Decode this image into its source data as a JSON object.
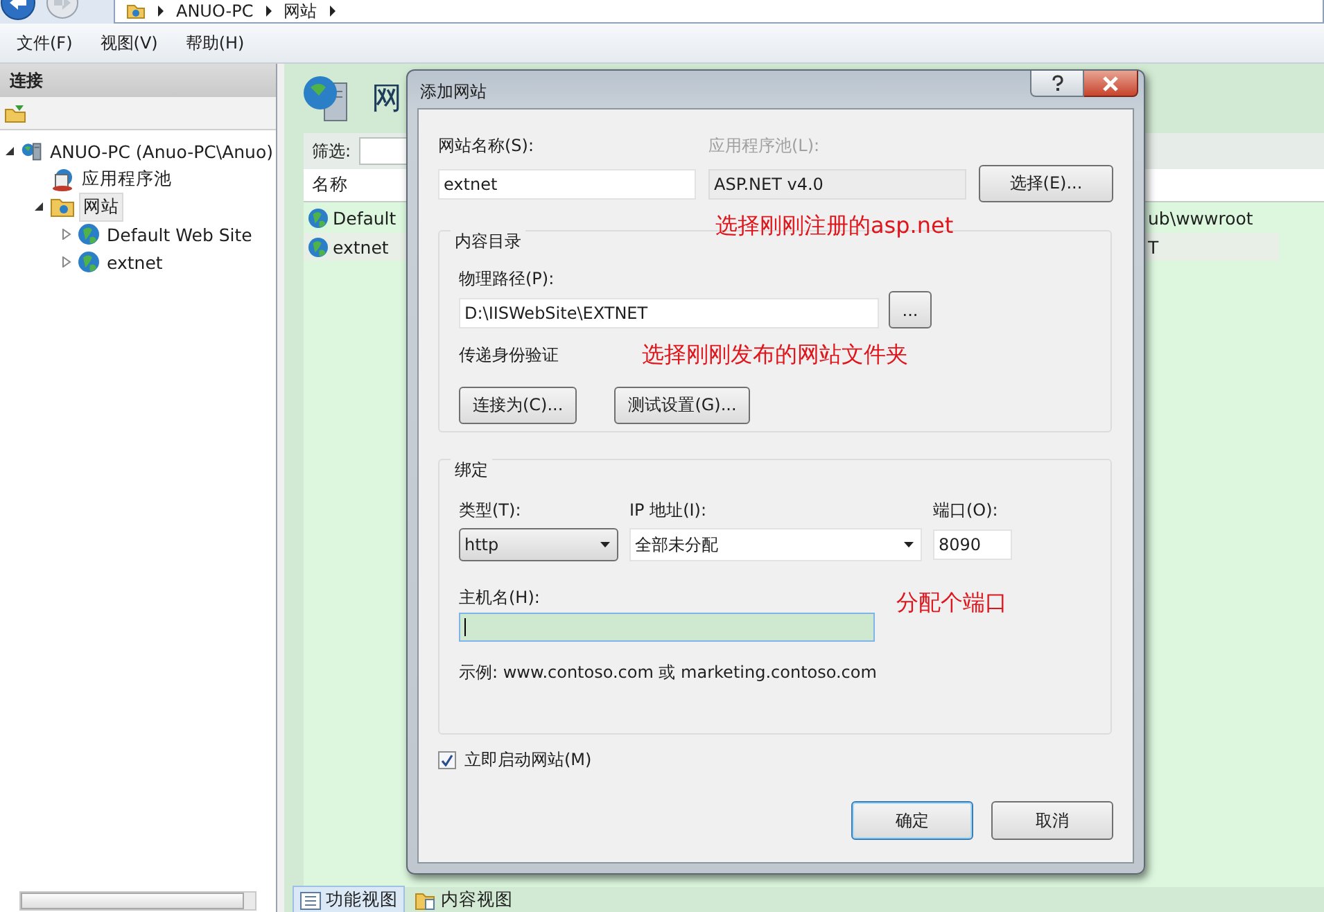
{
  "address_bar": {
    "crumbs": [
      "ANUO-PC",
      "网站"
    ]
  },
  "menu": [
    "文件(F)",
    "视图(V)",
    "帮助(H)"
  ],
  "connections": {
    "title": "连接",
    "tree": [
      {
        "label": "ANUO-PC (Anuo-PC\\Anuo)",
        "kind": "server",
        "expanded": true,
        "selected": false,
        "children": [
          {
            "label": "应用程序池",
            "kind": "pools",
            "selected": false
          },
          {
            "label": "网站",
            "kind": "sites",
            "expanded": true,
            "selected": true,
            "children": [
              {
                "label": "Default Web Site",
                "kind": "site",
                "expanded": false,
                "selected": false
              },
              {
                "label": "extnet",
                "kind": "site",
                "expanded": false,
                "selected": false
              }
            ]
          }
        ]
      }
    ]
  },
  "sites_page": {
    "title": "网",
    "filter_label": "筛选:",
    "columns": [
      "名称"
    ],
    "rows": [
      {
        "name": "Default",
        "column_2": "ub\\wwwroot",
        "selected": false
      },
      {
        "name": "extnet",
        "column_2": "T",
        "selected": true
      }
    ]
  },
  "view_tabs": [
    {
      "label": "功能视图",
      "selected": true
    },
    {
      "label": "内容视图",
      "selected": false
    }
  ],
  "dialog": {
    "title": "添加网站",
    "site_name": {
      "label": "网站名称(S):",
      "value": "extnet"
    },
    "app_pool": {
      "label": "应用程序池(L):",
      "value": "ASP.NET v4.0",
      "disabled": true,
      "note": "选择刚刚注册的asp.net"
    },
    "select_button": "选择(E)...",
    "content_group": {
      "title": "内容目录",
      "path_label": "物理路径(P):",
      "path_value": "D:\\IISWebSite\\EXTNET",
      "browse_button": "...",
      "auth_label": "传递身份验证",
      "note": "选择刚刚发布的网站文件夹",
      "buttons": [
        "连接为(C)...",
        "测试设置(G)..."
      ]
    },
    "binding_group": {
      "title": "绑定",
      "type": {
        "label": "类型(T):",
        "value": "http"
      },
      "ip": {
        "label": "IP 地址(I):",
        "value": "全部未分配"
      },
      "port": {
        "label": "端口(O):",
        "value": "8090"
      },
      "note": "分配个端口",
      "host": {
        "label": "主机名(H):",
        "focused": true
      },
      "example": "示例: www.contoso.com 或 marketing.contoso.com"
    },
    "start_now": {
      "label": "立即启动网站(M)",
      "checked": true
    },
    "buttons": [
      {
        "label": "确定",
        "default": true
      },
      {
        "label": "取消",
        "default": false
      }
    ]
  }
}
